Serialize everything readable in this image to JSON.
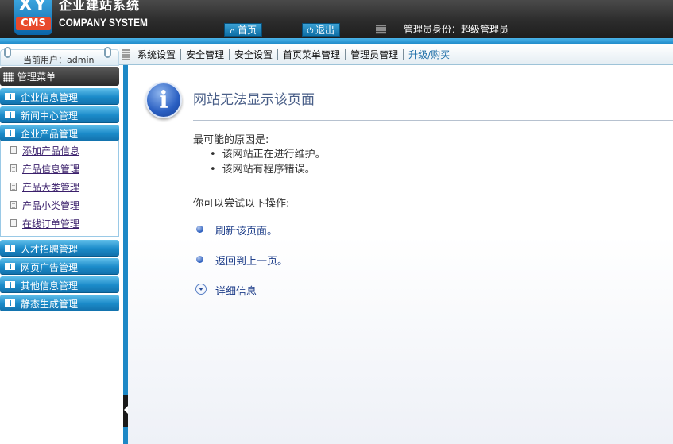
{
  "header": {
    "logo_text_top": "XY",
    "logo_text_bottom": "CMS",
    "brand_cn": "企业建站系统",
    "brand_en": "COMPANY SYSTEM",
    "home_label": "首页",
    "logout_label": "退出",
    "admin_identity": "管理员身份：超级管理员"
  },
  "nav": {
    "tabs": [
      {
        "label": "系统设置"
      },
      {
        "label": "安全管理"
      },
      {
        "label": "安全设置"
      },
      {
        "label": "首页菜单管理"
      },
      {
        "label": "管理员管理"
      },
      {
        "label": "升级/购买"
      }
    ]
  },
  "sidebar": {
    "current_user": "当前用户：admin",
    "menu_header": "管理菜单",
    "groups": [
      {
        "label": "企业信息管理"
      },
      {
        "label": "新闻中心管理"
      },
      {
        "label": "企业产品管理"
      },
      {
        "label": "人才招聘管理"
      },
      {
        "label": "网页广告管理"
      },
      {
        "label": "其他信息管理"
      },
      {
        "label": "静态生成管理"
      }
    ],
    "product_items": [
      {
        "label": "添加产品信息"
      },
      {
        "label": "产品信息管理"
      },
      {
        "label": "产品大类管理"
      },
      {
        "label": "产品小类管理"
      },
      {
        "label": "在线订单管理"
      }
    ]
  },
  "error_page": {
    "title": "网站无法显示该页面",
    "reasons_intro": "最可能的原因是:",
    "reasons": [
      "该网站正在进行维护。",
      "该网站有程序错误。"
    ],
    "actions_intro": "你可以尝试以下操作:",
    "refresh_label": "刷新该页面。",
    "back_label": "返回到上一页。",
    "details_label": "详细信息"
  },
  "colors": {
    "header_bg": "#2c2c2c",
    "accent_blue": "#1b8bc9",
    "link_blue": "#1f3f8a",
    "title_color": "#4a5f88"
  },
  "icons": {
    "home": "home-icon",
    "logout": "power-icon",
    "info": "info-icon",
    "document": "document-icon",
    "menu_group": "list-icon"
  }
}
